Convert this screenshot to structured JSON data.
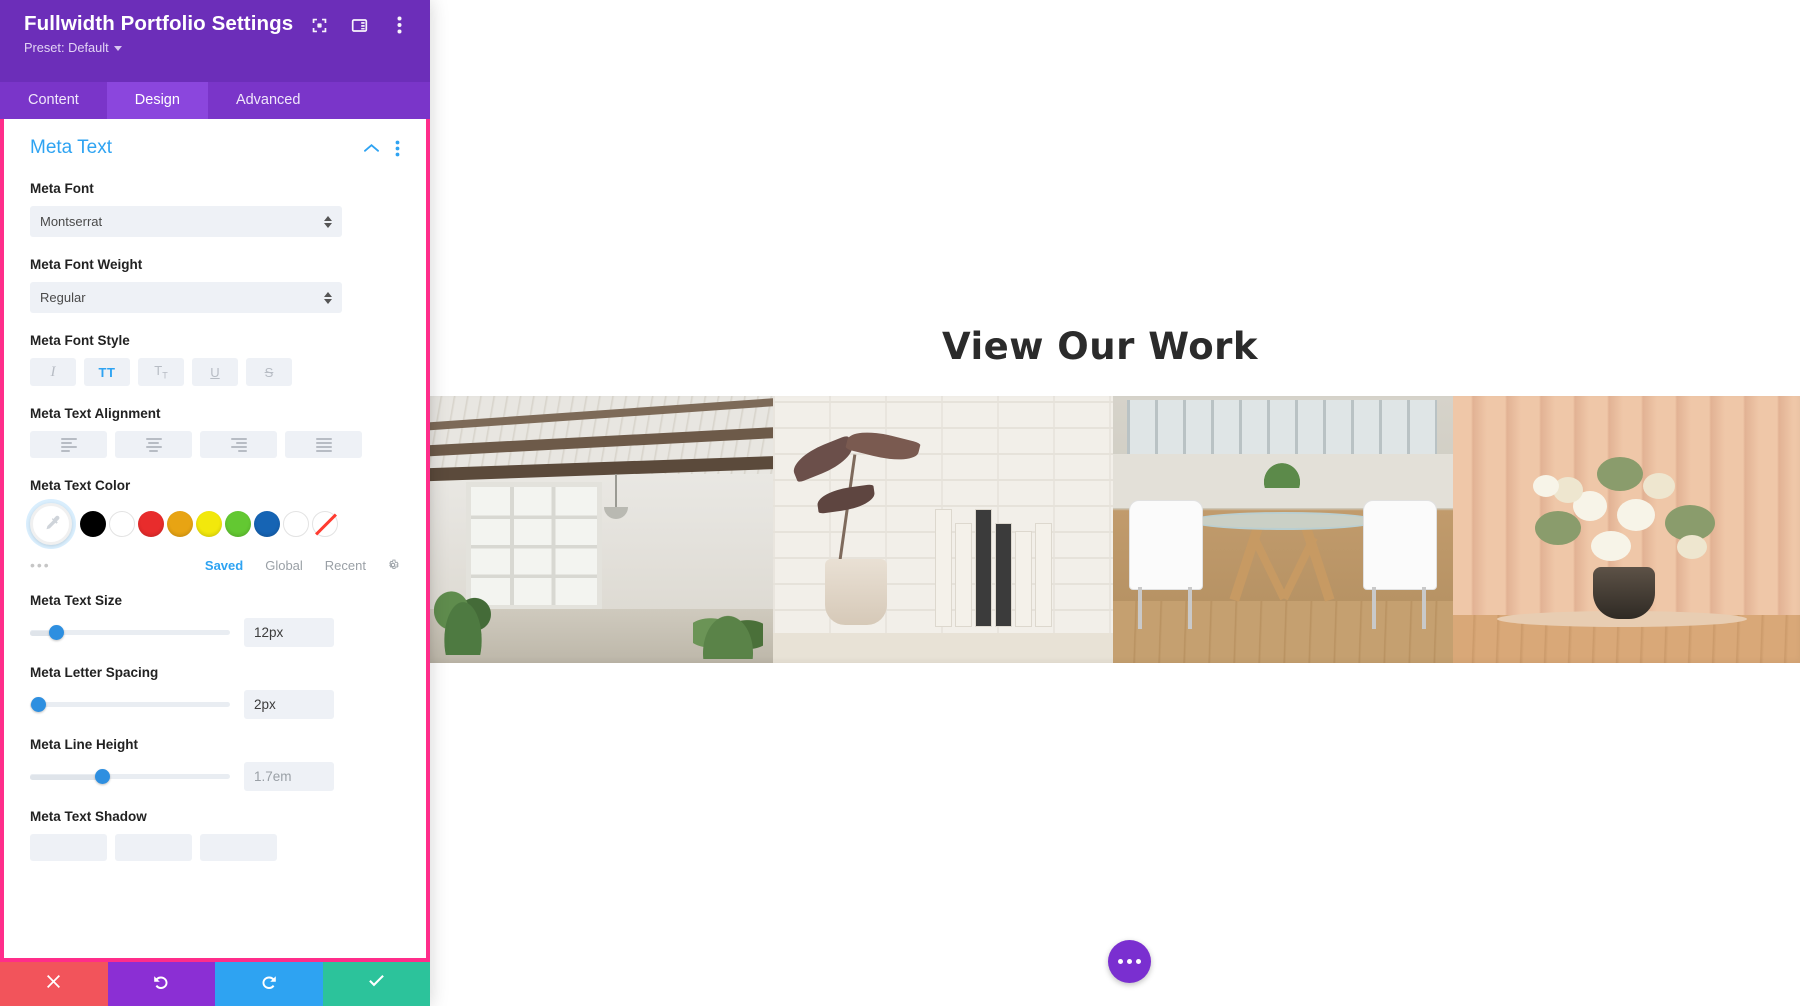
{
  "modal": {
    "title": "Fullwidth Portfolio Settings",
    "preset": "Preset: Default",
    "header_icons": [
      "focus-frame-icon",
      "layout-panel-icon",
      "vertical-dots-icon"
    ],
    "tabs": [
      {
        "label": "Content",
        "active": false
      },
      {
        "label": "Design",
        "active": true
      },
      {
        "label": "Advanced",
        "active": false
      }
    ],
    "section": {
      "title": "Meta Text",
      "collapse_icon": "chevron-up-icon",
      "more_icon": "vertical-dots-icon"
    },
    "fields": {
      "meta_font": {
        "label": "Meta Font",
        "value": "Montserrat"
      },
      "meta_font_weight": {
        "label": "Meta Font Weight",
        "value": "Regular"
      },
      "meta_font_style": {
        "label": "Meta Font Style",
        "options": [
          {
            "name": "italic",
            "glyph": "I",
            "active": false
          },
          {
            "name": "uppercase",
            "glyph": "TT",
            "active": true
          },
          {
            "name": "lowercase",
            "glyph": "T",
            "sub": "T",
            "active": false
          },
          {
            "name": "underline",
            "glyph": "U",
            "active": false
          },
          {
            "name": "strikethrough",
            "glyph": "S",
            "active": false
          }
        ]
      },
      "meta_text_alignment": {
        "label": "Meta Text Alignment",
        "options": [
          {
            "name": "align-left",
            "active": false
          },
          {
            "name": "align-center",
            "active": false
          },
          {
            "name": "align-right",
            "active": false
          },
          {
            "name": "align-justify",
            "active": false
          }
        ]
      },
      "meta_text_color": {
        "label": "Meta Text Color",
        "picker_icon": "eyedropper-icon",
        "swatches": [
          {
            "name": "black",
            "hex": "#000000"
          },
          {
            "name": "white",
            "hex": "#FFFFFF"
          },
          {
            "name": "red",
            "hex": "#E82C2C"
          },
          {
            "name": "orange",
            "hex": "#E8A413"
          },
          {
            "name": "yellow",
            "hex": "#F2E80C"
          },
          {
            "name": "green",
            "hex": "#63C832"
          },
          {
            "name": "blue",
            "hex": "#1664B4"
          },
          {
            "name": "white-2",
            "hex": "#FFFFFF"
          }
        ],
        "none_swatch": "transparent-none",
        "more_dots": "•••",
        "links": [
          {
            "label": "Saved",
            "active": true
          },
          {
            "label": "Global",
            "active": false
          },
          {
            "label": "Recent",
            "active": false
          }
        ],
        "gear_icon": "gear-icon"
      },
      "meta_text_size": {
        "label": "Meta Text Size",
        "value": "12px",
        "slider_percent": 13
      },
      "meta_letter_spacing": {
        "label": "Meta Letter Spacing",
        "value": "2px",
        "slider_percent": 4
      },
      "meta_line_height": {
        "label": "Meta Line Height",
        "value": "1.7em",
        "slider_percent": 36,
        "muted": true
      },
      "meta_text_shadow": {
        "label": "Meta Text Shadow"
      }
    },
    "footer": [
      {
        "name": "cancel-button",
        "icon": "close-x-icon",
        "color": "#f2545b"
      },
      {
        "name": "undo-button",
        "icon": "undo-arrow-icon",
        "color": "#8b2fd4"
      },
      {
        "name": "redo-button",
        "icon": "redo-arrow-icon",
        "color": "#2ea3f2"
      },
      {
        "name": "save-button",
        "icon": "checkmark-icon",
        "color": "#2cc39b"
      }
    ]
  },
  "preview": {
    "heading": "View Our Work",
    "gallery": [
      {
        "name": "loft-interior-photo",
        "alt": "White loft with wood beams and windows"
      },
      {
        "name": "white-brick-plant-books-photo",
        "alt": "White brick wall with plant and books"
      },
      {
        "name": "dining-table-chairs-photo",
        "alt": "Glass dining table with white chairs"
      },
      {
        "name": "flower-vase-curtain-photo",
        "alt": "Flower arrangement by peach curtains"
      }
    ],
    "fab": {
      "name": "page-options-fab",
      "icon": "horizontal-dots-icon",
      "color": "#7a2fd0"
    }
  }
}
